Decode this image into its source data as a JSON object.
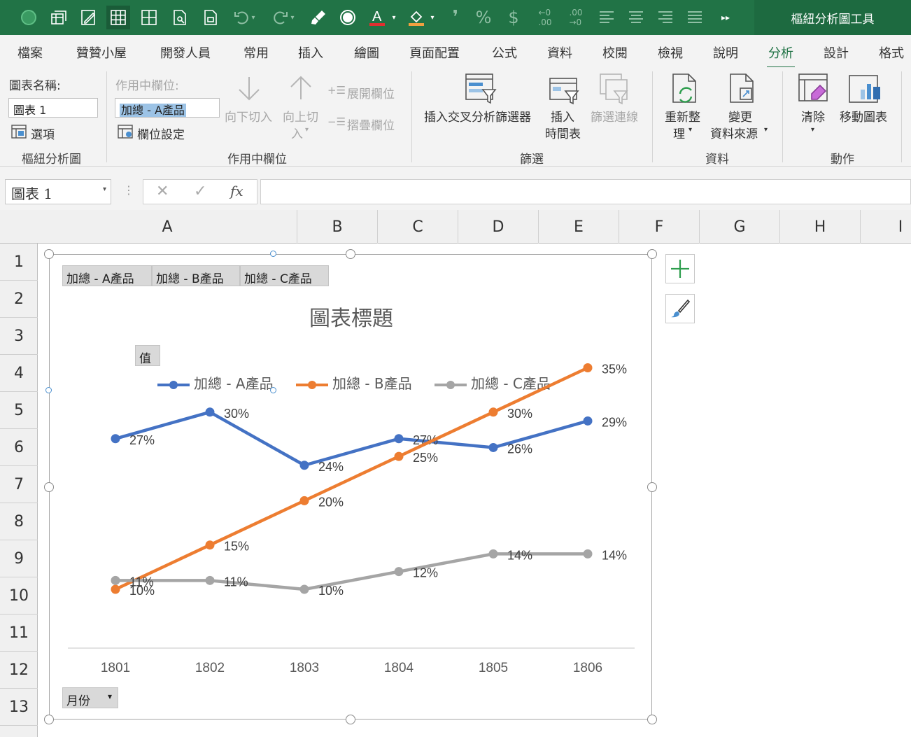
{
  "titlebar": {
    "context_tools": "樞紐分析圖工具",
    "icons": [
      "autosave-toggle-icon",
      "pivot-icon",
      "edit-icon",
      "table-grid-icon",
      "grid-icon",
      "print-preview-icon",
      "export-icon",
      "undo-icon",
      "redo-icon",
      "format-painter-icon",
      "circle-icon",
      "font-color-icon",
      "fill-color-icon",
      "comma-icon",
      "percent-icon",
      "currency-icon",
      "decimal-increase-icon",
      "decimal-decrease-icon",
      "align-left-icon",
      "align-center-icon",
      "align-right-icon",
      "justify-icon",
      "more-icon"
    ]
  },
  "tabs": [
    "檔案",
    "贊贊小屋",
    "開發人員",
    "常用",
    "插入",
    "繪圖",
    "頁面配置",
    "公式",
    "資料",
    "校閱",
    "檢視",
    "說明",
    "分析",
    "設計",
    "格式"
  ],
  "active_tab": "分析",
  "ribbon": {
    "chart_name_label": "圖表名稱:",
    "chart_name_value": "圖表 1",
    "options_label": "選項",
    "group_pivotchart": "樞紐分析圖",
    "active_field_label": "作用中欄位:",
    "active_field_value": "加總 - A產品",
    "field_settings": "欄位設定",
    "drill_down": "向下切入",
    "drill_up_1": "向上切",
    "drill_up_2": "入",
    "expand_field": "展開欄位",
    "collapse_field": "摺疊欄位",
    "group_active_field": "作用中欄位",
    "insert_slicer": "插入交叉分析篩選器",
    "insert_timeline_1": "插入",
    "insert_timeline_2": "時間表",
    "filter_connections": "篩選連線",
    "group_filter": "篩選",
    "refresh_1": "重新整",
    "refresh_2": "理",
    "change_source_1": "變更",
    "change_source_2": "資料來源",
    "group_data": "資料",
    "clear": "清除",
    "move_chart": "移動圖表",
    "group_actions": "動作"
  },
  "formula_bar": {
    "name_box": "圖表 1",
    "cancel": "✕",
    "enter": "✓",
    "fx": "fx"
  },
  "columns": [
    "A",
    "B",
    "C",
    "D",
    "E",
    "F",
    "G",
    "H",
    "I"
  ],
  "rows": [
    "1",
    "2",
    "3",
    "4",
    "5",
    "6",
    "7",
    "8",
    "9",
    "10",
    "11",
    "12",
    "13"
  ],
  "chart": {
    "field_buttons": [
      "加總 - A產品",
      "加總 - B產品",
      "加總 - C產品"
    ],
    "value_button": "值",
    "axis_field_button": "月份",
    "title": "圖表標題"
  },
  "chart_data": {
    "type": "line",
    "title": "圖表標題",
    "categories": [
      "1801",
      "1802",
      "1803",
      "1804",
      "1805",
      "1806"
    ],
    "legend_position": "top",
    "grid": false,
    "ylim": [
      0,
      0.4
    ],
    "series": [
      {
        "name": "加總 - A產品",
        "color": "#4472c4",
        "values": [
          0.27,
          0.3,
          0.24,
          0.27,
          0.26,
          0.29
        ],
        "labels": [
          "27%",
          "30%",
          "24%",
          "27%",
          "26%",
          "29%"
        ]
      },
      {
        "name": "加總 - B產品",
        "color": "#ed7d31",
        "values": [
          0.1,
          0.15,
          0.2,
          0.25,
          0.3,
          0.35
        ],
        "labels": [
          "10%",
          "15%",
          "20%",
          "25%",
          "30%",
          "35%"
        ]
      },
      {
        "name": "加總 - C產品",
        "color": "#a5a5a5",
        "values": [
          0.11,
          0.11,
          0.1,
          0.12,
          0.14,
          0.14
        ],
        "labels": [
          "11%",
          "11%",
          "10%",
          "12%",
          "14%",
          "14%"
        ]
      }
    ]
  },
  "side_buttons": [
    "add-chart-element-icon",
    "chart-styles-brush-icon"
  ]
}
